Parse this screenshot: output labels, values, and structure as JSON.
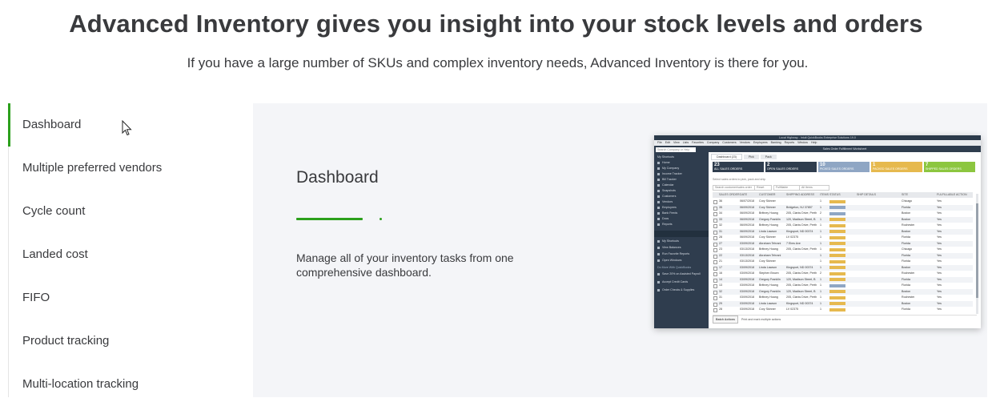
{
  "hero": {
    "title": "Advanced Inventory gives you insight into your stock levels and orders",
    "subtitle": "If you have a large number of SKUs and complex inventory needs, Advanced Inventory is there for you."
  },
  "tabs": [
    {
      "label": "Dashboard",
      "active": true
    },
    {
      "label": "Multiple preferred vendors",
      "active": false
    },
    {
      "label": "Cycle count",
      "active": false
    },
    {
      "label": "Landed cost",
      "active": false
    },
    {
      "label": "FIFO",
      "active": false
    },
    {
      "label": "Product tracking",
      "active": false
    },
    {
      "label": "Multi-location tracking",
      "active": false
    }
  ],
  "panel": {
    "title": "Dashboard",
    "description": "Manage all of your inventory tasks from one comprehensive dashboard.",
    "progress_fraction": 0.9
  },
  "colors": {
    "accent_green": "#2ca01c",
    "panel_bg": "#f4f5f8",
    "text": "#393a3d"
  },
  "screenshot": {
    "window_title": "Local Highway - Intuit QuickBooks Enterprise Solutions 19.0",
    "menu": [
      "File",
      "Edit",
      "View",
      "Lists",
      "Favorites",
      "Company",
      "Customers",
      "Vendors",
      "Employees",
      "Banking",
      "Reports",
      "Window",
      "Help"
    ],
    "search_placeholder": "Search Company or Help",
    "sidebar_items": [
      "My Shortcuts",
      "Home",
      "My Company",
      "Income Tracker",
      "Bill Tracker",
      "Calendar",
      "Snapshots",
      "Customers",
      "Vendors",
      "Employees",
      "Bank Feeds",
      "Docs",
      "Reports"
    ],
    "sidebar_lower": [
      "My Shortcuts",
      "View Balances",
      "Run Favorite Reports",
      "Open Windows"
    ],
    "sidebar_promo": [
      "Save 20% on Assisted Payroll",
      "Accept Credit Cards",
      "Order Checks & Supplies"
    ],
    "sidebar_promo_header": "Do More With QuickBooks",
    "header": "Sales Order Fulfillment Worksheet",
    "tabs": [
      "Dashboard (23)",
      "Pick",
      "Pack"
    ],
    "cards": [
      {
        "value": "23",
        "label": "ALL SALES ORDERS",
        "color": "#2f3d4e"
      },
      {
        "value": "2",
        "label": "OPEN SALES ORDERS",
        "color": "#2f3d4e"
      },
      {
        "value": "10",
        "label": "PICKED SALES ORDERS",
        "color": "#8fa6c4"
      },
      {
        "value": "1",
        "label": "PACKED SALES ORDERS",
        "color": "#e6b94e"
      },
      {
        "value": "7",
        "label": "SHIPPED SALES ORDERS",
        "color": "#8cc63f"
      }
    ],
    "filter_text": "Select sales orders to pick, pack and ship",
    "controls": [
      "Search customer/sales order",
      "Reset",
      "Fulfillable",
      "All Items"
    ],
    "columns": [
      "SALES ORDER",
      "DATE",
      "CUSTOMER",
      "SHIPPING ADDRESS",
      "ITEMS",
      "STATUS",
      "SHIP DETAILS",
      "SITE",
      "FULFILLABLE",
      "ACTION"
    ],
    "rows": [
      {
        "so": "36",
        "date": "06/07/2018",
        "customer": "Cory Skinner",
        "addr": "",
        "items": "1",
        "status": "#e6b94e",
        "site": "Chicago",
        "ful": "Yes"
      },
      {
        "so": "35",
        "date": "06/09/2018",
        "customer": "Cory Skinner",
        "addr": "Bridgeton, NJ 37857",
        "items": "1",
        "status": "#8fa6c4",
        "site": "Florida",
        "ful": "Yes"
      },
      {
        "so": "34",
        "date": "06/09/2018",
        "customer": "Brittney Hoang",
        "addr": "205, Clarks Drive, Perth",
        "items": "2",
        "status": "#8fa6c4",
        "site": "Boston",
        "ful": "Yes"
      },
      {
        "so": "33",
        "date": "06/09/2018",
        "customer": "Gregory Franklin",
        "addr": "120, Madison Street, B",
        "items": "1",
        "status": "#e6b94e",
        "site": "Boston",
        "ful": "Yes"
      },
      {
        "so": "32",
        "date": "06/09/2018",
        "customer": "Brittney Hoang",
        "addr": "205, Clarks Drive, Perth",
        "items": "1",
        "status": "#e6b94e",
        "site": "Rochester",
        "ful": "Yes"
      },
      {
        "so": "31",
        "date": "06/09/2018",
        "customer": "Linda Lawson",
        "addr": "Kingsport, ND 00374",
        "items": "1",
        "status": "#e6b94e",
        "site": "Boston",
        "ful": "Yes"
      },
      {
        "so": "28",
        "date": "06/09/2018",
        "customer": "Cory Skinner",
        "addr": "LV 02375",
        "items": "1",
        "status": "#e6b94e",
        "site": "Florida",
        "ful": "Yes"
      },
      {
        "so": "27",
        "date": "03/09/2018",
        "customer": "Abraham Tehrani",
        "addr": "7 Elms Ave",
        "items": "1",
        "status": "#e6b94e",
        "site": "Florida",
        "ful": "Yes"
      },
      {
        "so": "23",
        "date": "03/13/2018",
        "customer": "Brittney Hoang",
        "addr": "205, Clarks Drive, Perth",
        "items": "1",
        "status": "#e6b94e",
        "site": "Chicago",
        "ful": "Yes"
      },
      {
        "so": "22",
        "date": "03/13/2018",
        "customer": "Abraham Tehrani",
        "addr": "",
        "items": "1",
        "status": "#e6b94e",
        "site": "Florida",
        "ful": "Yes"
      },
      {
        "so": "21",
        "date": "03/13/2018",
        "customer": "Cory Skinner",
        "addr": "",
        "items": "1",
        "status": "#e6b94e",
        "site": "Florida",
        "ful": "Yes"
      },
      {
        "so": "17",
        "date": "03/09/2018",
        "customer": "Linda Lawson",
        "addr": "Kingsport, ND 00374",
        "items": "1",
        "status": "#e6b94e",
        "site": "Boston",
        "ful": "Yes"
      },
      {
        "so": "16",
        "date": "03/09/2018",
        "customer": "Stephen Brown",
        "addr": "205, Clarks Drive, Perth",
        "items": "2",
        "status": "#e6b94e",
        "site": "Rochester",
        "ful": "Yes"
      },
      {
        "so": "14",
        "date": "03/09/2018",
        "customer": "Gregory Franklin",
        "addr": "120, Madison Street, B",
        "items": "1",
        "status": "#e6b94e",
        "site": "Florida",
        "ful": "Yes"
      },
      {
        "so": "13",
        "date": "03/09/2018",
        "customer": "Brittney Hoang",
        "addr": "205, Clarks Drive, Perth",
        "items": "1",
        "status": "#8fa6c4",
        "site": "Florida",
        "ful": "Yes"
      },
      {
        "so": "32",
        "date": "03/09/2018",
        "customer": "Gregory Franklin",
        "addr": "120, Madison Street, B",
        "items": "1",
        "status": "#e6b94e",
        "site": "Boston",
        "ful": "Yes"
      },
      {
        "so": "31",
        "date": "03/09/2018",
        "customer": "Brittney Hoang",
        "addr": "205, Clarks Drive, Perth",
        "items": "1",
        "status": "#e6b94e",
        "site": "Rochester",
        "ful": "Yes"
      },
      {
        "so": "29",
        "date": "03/09/2018",
        "customer": "Linda Lawson",
        "addr": "Kingsport, ND 00374",
        "items": "1",
        "status": "#e6b94e",
        "site": "Boston",
        "ful": "Yes"
      },
      {
        "so": "28",
        "date": "03/09/2018",
        "customer": "Cory Skinner",
        "addr": "LV 02375",
        "items": "1",
        "status": "#e6b94e",
        "site": "Florida",
        "ful": "Yes"
      }
    ],
    "footer_button": "Batch Actions",
    "footer_text": "Print and mark multiple actions"
  }
}
